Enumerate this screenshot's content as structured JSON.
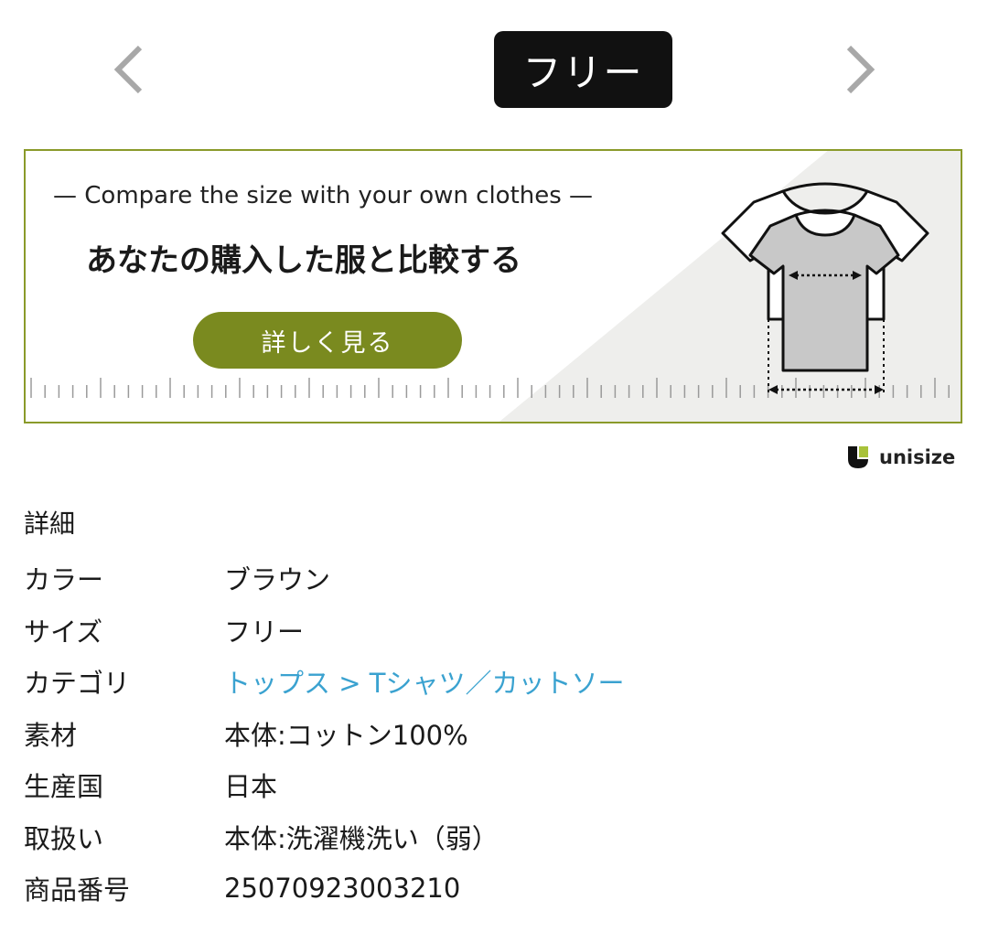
{
  "size_nav": {
    "prev_icon": "chevron-left-icon",
    "next_icon": "chevron-right-icon",
    "selected_size": "フリー"
  },
  "banner": {
    "english_text": "— Compare the size with your own clothes —",
    "japanese_text": "あなたの購入した服と比較する",
    "button_label": "詳しく見る",
    "accent_color": "#7a8a1f",
    "border_color": "#8a9a2a",
    "illustration": "t-shirt-compare-icon"
  },
  "unisize": {
    "logo_icon": "unisize-logo-icon",
    "label": "unisize"
  },
  "details": {
    "heading": "詳細",
    "rows": [
      {
        "key": "カラー",
        "value": "ブラウン"
      },
      {
        "key": "サイズ",
        "value": "フリー"
      },
      {
        "key": "カテゴリ",
        "value": "トップス > Tシャツ／カットソー",
        "link": true
      },
      {
        "key": "素材",
        "value": "本体:コットン100%"
      },
      {
        "key": "生産国",
        "value": "日本"
      },
      {
        "key": "取扱い",
        "value": "本体:洗濯機洗い（弱）"
      },
      {
        "key": "商品番号",
        "value": "25070923003210"
      }
    ],
    "link_color": "#3aa2d0"
  }
}
